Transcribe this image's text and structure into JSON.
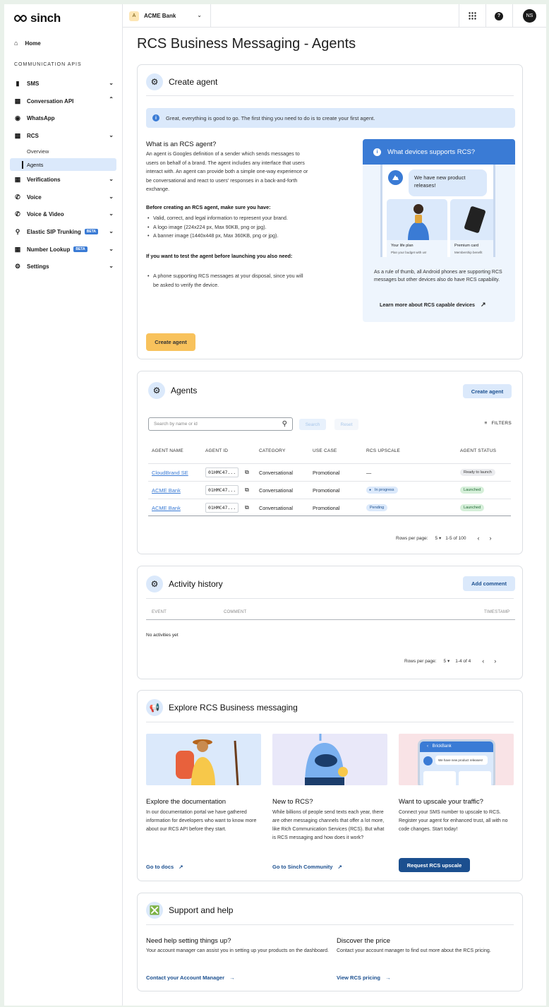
{
  "brand": {
    "logo_text": "sinch"
  },
  "topbar": {
    "org_initial": "A",
    "org_name": "ACME Bank",
    "avatar": "NS",
    "help": "?"
  },
  "sidebar": {
    "home": "Home",
    "section": "COMMUNICATION APIS",
    "items": [
      {
        "label": "SMS",
        "icon": "sms-icon"
      },
      {
        "label": "Conversation API",
        "icon": "conversation-icon"
      },
      {
        "label": "WhatsApp",
        "icon": "whatsapp-icon"
      },
      {
        "label": "RCS",
        "icon": "rcs-icon"
      },
      {
        "label": "Verifications",
        "icon": "verification-icon"
      },
      {
        "label": "Voice",
        "icon": "voice-icon"
      },
      {
        "label": "Voice & Video",
        "icon": "video-icon"
      },
      {
        "label": "Elastic SIP Trunking",
        "icon": "sip-icon",
        "badge": "BETA"
      },
      {
        "label": "Number Lookup",
        "icon": "lookup-icon",
        "badge": "BETA"
      },
      {
        "label": "Settings",
        "icon": "gear-icon"
      }
    ],
    "rcs_sub": {
      "overview": "Overview",
      "agents": "Agents"
    }
  },
  "page": {
    "title": "RCS Business Messaging - Agents"
  },
  "create": {
    "title": "Create agent",
    "info": "Great, everything is good to go. The first thing you need to do is to create your first agent.",
    "what_title": "What is an RCS agent?",
    "what_text": "An agent is Googles definition of a sender which sends messages to users on behalf of a brand. The agent includes any interface that users interact with. An agent can provide both a simple one-way experience or be conversational and react to users' responses in a back-and-forth exchange.",
    "before_title": "Before creating an RCS agent, make sure you have:",
    "before_items": [
      "Valid, correct, and legal information to represent your brand.",
      "A logo image (224x224 px, Max 90KB, png or jpg).",
      "A banner image (1440x448 px, Max 360KB, png or jpg)."
    ],
    "test_title": "If you want to test the agent before launching you also need:",
    "test_items": [
      "A phone supporting RCS messages at your disposal, since you will be asked to verify the device."
    ],
    "button": "Create agent",
    "promo": {
      "title": "What devices supports RCS?",
      "bubble": "We have new product releases!",
      "card1_title": "Your life plan",
      "card1_sub": "Plan your budget with us!",
      "card2_title": "Premium card",
      "card2_sub": "Membership benefit",
      "text": "As a rule of thumb, all Android phones are supporting RCS messages but other devices also do have RCS capability.",
      "link": "Learn more about RCS capable devices"
    }
  },
  "agents": {
    "title": "Agents",
    "create_button": "Create agent",
    "search_placeholder": "Search by name or id",
    "search_button": "Search",
    "reset_button": "Reset",
    "filters": "FILTERS",
    "columns": [
      "AGENT NAME",
      "AGENT ID",
      "CATEGORY",
      "USE CASE",
      "RCS UPSCALE",
      "AGENT STATUS"
    ],
    "rows": [
      {
        "name": "CloudBrand SE",
        "id": "01HMC47...",
        "category": "Conversational",
        "use_case": "Promotional",
        "upscale": "—",
        "status": "Ready to launch"
      },
      {
        "name": "ACME Bank",
        "id": "01HMC47...",
        "category": "Conversational",
        "use_case": "Promotional",
        "upscale": "In progress",
        "status": "Launched"
      },
      {
        "name": "ACME Bank",
        "id": "01HMC47...",
        "category": "Conversational",
        "use_case": "Promotional",
        "upscale": "Pending",
        "status": "Launched"
      }
    ],
    "pager": {
      "label": "Rows per page:",
      "size": "5",
      "range": "1-5 of 100"
    }
  },
  "activity": {
    "title": "Activity history",
    "button": "Add comment",
    "columns": [
      "EVENT",
      "COMMENT",
      "TIMESTAMP"
    ],
    "empty": "No activities yet",
    "pager": {
      "label": "Rows per page:",
      "size": "5",
      "range": "1-4 of 4"
    }
  },
  "explore": {
    "title": "Explore RCS Business messaging",
    "cards": [
      {
        "title": "Explore the documentation",
        "text": "In our documentation portal we have gathered information for developers who want to know more about our RCS API before they start.",
        "link": "Go to docs"
      },
      {
        "title": "New to RCS?",
        "text": "While billions of people send texts each year, there are other messaging channels that offer a lot more, like Rich Communication Services (RCS). But what is RCS messaging and how does it work?",
        "link": "Go to Sinch Community"
      },
      {
        "title": "Want to upscale your traffic?",
        "text": "Connect your SMS number to upscale to RCS. Register your agent for enhanced trust, all with no code changes. Start today!",
        "button": "Request RCS upscale"
      }
    ],
    "brickbank": "BrickBank",
    "mini_bubble": "We have new product releases!"
  },
  "support": {
    "title": "Support and help",
    "left_title": "Need help setting things up?",
    "left_text": "Your account manager can assist you in setting up your products on the dashboard.",
    "left_link": "Contact your Account Manager",
    "right_title": "Discover the price",
    "right_text": "Contact your account manager to find out more about the RCS pricing.",
    "right_link": "View RCS pricing"
  },
  "colors": {
    "accent": "#3a7bd5",
    "navy": "#1b4f8f",
    "yellow": "#f8c25c",
    "light_blue": "#dbe9fb"
  }
}
